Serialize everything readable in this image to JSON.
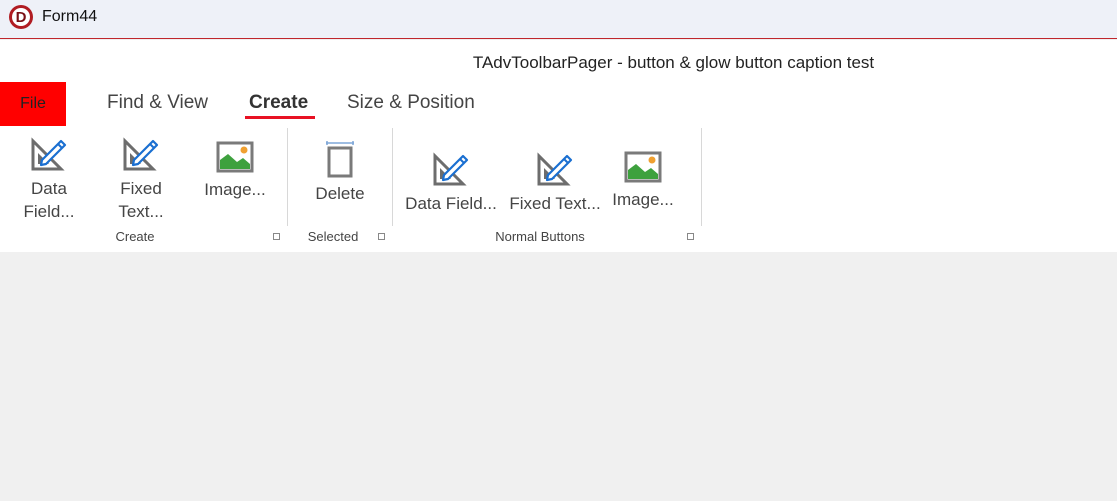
{
  "window": {
    "title": "Form44",
    "logo_letter": "D"
  },
  "ribbon": {
    "caption": "TAdvToolbarPager - button & glow button caption test",
    "file_tab": "File",
    "tabs": [
      "Find & View",
      "Create",
      "Size & Position"
    ],
    "active_tab": "Create",
    "groups": [
      {
        "label": "Create",
        "buttons": [
          {
            "line1": "Data",
            "line2": "Field...",
            "icon": "data-field-icon"
          },
          {
            "line1": "Fixed",
            "line2": "Text...",
            "icon": "fixed-text-icon"
          },
          {
            "label": "Image...",
            "icon": "image-icon"
          }
        ]
      },
      {
        "label": "Selected",
        "buttons": [
          {
            "label": "Delete",
            "icon": "delete-icon"
          }
        ]
      },
      {
        "label": "Normal Buttons",
        "buttons": [
          {
            "label": "Data Field...",
            "icon": "data-field-icon"
          },
          {
            "label": "Fixed Text...",
            "icon": "fixed-text-icon"
          },
          {
            "label": "Image...",
            "icon": "image-icon"
          }
        ]
      }
    ]
  },
  "colors": {
    "file_tab_bg": "#ff0000",
    "tab_underline": "#e81123",
    "icon_blue": "#1a6fd1",
    "icon_gray": "#6d6d6d"
  }
}
